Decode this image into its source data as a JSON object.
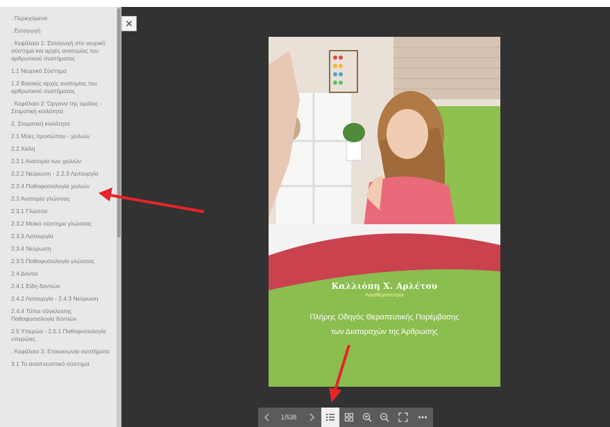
{
  "sidebar": {
    "items": [
      ". Περιεχόμενα",
      ". Εισαγωγή",
      ". Κεφάλαιο 1: Εισαγωγή στο νευρικό σύστημα και αρχές ανατομίας του αρθρωτικού συστήματος",
      "1.1 Νευρικό Σύστημα",
      "1.2 Βασικές αρχές ανατομίας του αρθρωτικού συστήματος",
      ". Κεφάλαιο 2: Όργανα της ομιλίας - Στοματική κοιλότητα",
      "2. Στοματική κοιλότητα",
      "2.1 Μύες προσώπου - χειλιών",
      "2.2 Χείλη",
      "2.2.1 Ανατομία των χειλιών",
      "2.2.2 Νεύρωση - 2.2.3 Λειτουργία",
      "2.2.4 Παθοφυσιολογία χειλιών",
      "2.3 Ανατομία γλώσσας",
      "2.3.1 Γλώσσα",
      "2.3.2 Μυϊκό σύστημα γλώσσας",
      "2.3.3 Λειτουργία",
      "2.3.4 Νεύρωση",
      "2.3.5 Παθοφυσιολογία γλώσσας",
      "2.4 Δόντια",
      "2.4.1 Είδη δοντιών",
      "2.4.2 Λειτουργία - 2.4.3 Νεύρωση",
      "2.4.4 Τύποι σύγκλεισης Παθοφυσιολογία δοντιών",
      "2.5 Υπερώα - 2.5.1 Παθοφυσιολογία υπερώας",
      ". Κεφάλαιο 3: Επικοινωνία συστήματα",
      "3.1 Το αναπνευστικό σύστημα"
    ]
  },
  "book": {
    "author": "Καλλιόπη Χ. Αρλέτου",
    "role": "Λογοθεραπεύτρια",
    "title_line1": "Πλήρης Οδηγός Θεραπευτικής Παρέμβασης",
    "title_line2": "των Διαταραχών της Άρθρωσης"
  },
  "toolbar": {
    "page_count": "1/538",
    "icons": [
      "chevron-left-icon",
      "chevron-right-icon",
      "toc-list-icon",
      "thumbnails-grid-icon",
      "zoom-in-icon",
      "zoom-out-icon",
      "fullscreen-icon",
      "more-icon"
    ]
  },
  "close_icon": "close-icon",
  "colors": {
    "background": "#323232",
    "sidebar_bg": "#e8e8e8",
    "cover_green": "#8bbd4f",
    "cover_red": "#c9424e",
    "annotation_arrow": "#e8232a"
  }
}
